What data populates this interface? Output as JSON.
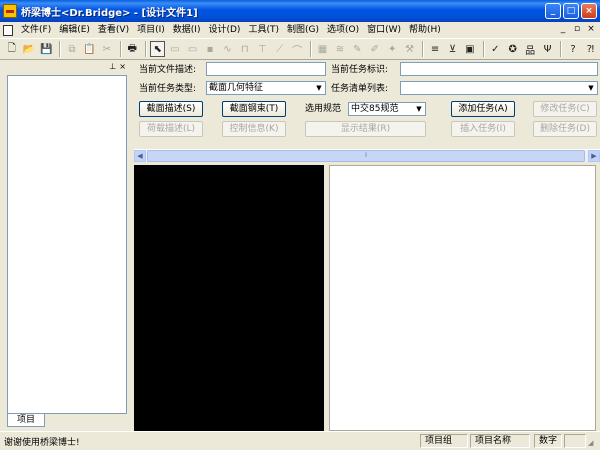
{
  "window": {
    "title": "桥梁博士<Dr.Bridge> - [设计文件1]",
    "buttons": {
      "minimize": "_",
      "maximize": "□",
      "close": "×"
    }
  },
  "menu": {
    "items": [
      "文件(F)",
      "编辑(E)",
      "查看(V)",
      "项目(I)",
      "数据(I)",
      "设计(D)",
      "工具(T)",
      "制图(G)",
      "选项(O)",
      "窗口(W)",
      "帮助(H)"
    ],
    "mdi": {
      "minimize": "_",
      "restore": "▫",
      "close": "×"
    }
  },
  "left_panel": {
    "header_buttons": [
      "⊥",
      "×"
    ],
    "tab_label": "项目"
  },
  "form": {
    "doc_desc_label": "当前文件描述:",
    "task_id_label": "当前任务标识:",
    "task_type_label": "当前任务类型:",
    "task_type_value": "截面几何特征",
    "task_list_label": "任务清单列表:",
    "standard_label": "选用规范",
    "standard_value": "中交85规范",
    "buttons": {
      "section_desc": "截面描述(S)",
      "section_rebar": "截面钢束(T)",
      "add_task": "添加任务(A)",
      "modify_task": "修改任务(C)",
      "load_desc": "荷载描述(L)",
      "control_info": "控制信息(K)",
      "show_result": "显示结果(R)",
      "insert_task": "插入任务(I)",
      "delete_task": "删除任务(D)"
    }
  },
  "status": {
    "message": "谢谢使用桥梁博士!",
    "panes": [
      "项目组",
      "项目名称",
      "数字"
    ]
  }
}
